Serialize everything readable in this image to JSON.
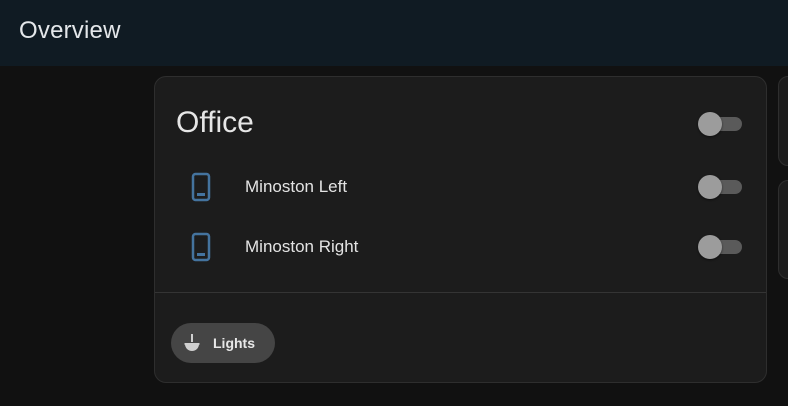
{
  "header": {
    "title": "Overview"
  },
  "card": {
    "title": "Office",
    "entities": [
      {
        "name": "Minoston Left",
        "icon": "phone-icon",
        "state": "off"
      },
      {
        "name": "Minoston Right",
        "icon": "phone-icon",
        "state": "off"
      }
    ],
    "master_toggle": "off",
    "chip": {
      "label": "Lights",
      "icon": "ceiling-light-icon"
    }
  },
  "colors": {
    "header_bg": "#101b23",
    "page_bg": "#111111",
    "card_bg": "#1c1c1c",
    "icon_accent": "#44739e",
    "chip_bg": "#454545"
  }
}
